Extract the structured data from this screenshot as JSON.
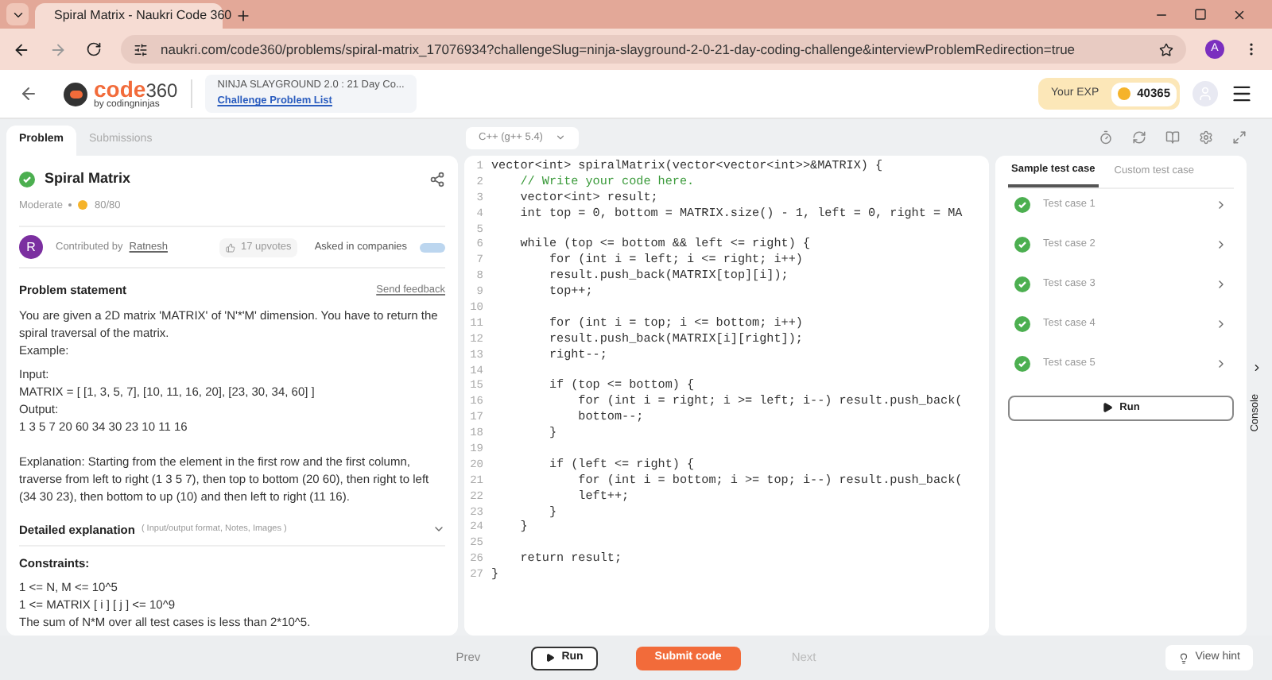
{
  "browser": {
    "tab_title": "Spiral Matrix - Naukri Code 360",
    "url": "naukri.com/code360/problems/spiral-matrix_17076934?challengeSlug=ninja-slayground-2-0-21-day-coding-challenge&interviewProblemRedirection=true",
    "profile_initial": "A"
  },
  "header": {
    "logo_main": "code",
    "logo_num": "360",
    "logo_sub": "by codingninjas",
    "challenge_title": "NINJA SLAYGROUND 2.0 : 21 Day Co...",
    "challenge_link": "Challenge Problem List",
    "exp_label": "Your EXP",
    "exp_value": "40365"
  },
  "problem_tabs": [
    {
      "label": "Problem",
      "selected": true
    },
    {
      "label": "Submissions",
      "selected": false
    }
  ],
  "language": "C++ (g++ 5.4)",
  "problem": {
    "title": "Spiral Matrix",
    "solved": true,
    "difficulty": "Moderate",
    "score": "80/80",
    "avatar_initial": "R",
    "contributed_label": "Contributed by",
    "contributor": "Ratnesh",
    "upvotes": "17 upvotes",
    "asked_label": "Asked in companies",
    "statement_heading": "Problem statement",
    "feedback": "Send feedback",
    "paragraphs": [
      "You are given a 2D matrix 'MATRIX' of 'N'*'M' dimension. You have to return the spiral traversal of the matrix.",
      "Example:"
    ],
    "example": [
      "Input:",
      "MATRIX = [ [1, 3, 5, 7], [10, 11, 16, 20], [23, 30, 34, 60] ]",
      "Output:",
      "1 3 5 7 20 60 34 30 23 10 11 16"
    ],
    "explanation": "Explanation: Starting from the element in the first row and the first column, traverse from left to right (1 3 5 7), then top to bottom (20 60), then right to left (34 30 23), then bottom to up (10) and then left to right (11 16).",
    "detailed_heading": "Detailed explanation",
    "detailed_hint": "( Input/output format, Notes, Images )",
    "expanded": false,
    "constraints_heading": "Constraints:",
    "constraints": [
      "1 <= N, M <= 10^5",
      "1 <= MATRIX [ i ] [ j ] <= 10^9",
      "The sum of N*M over all test cases is less than 2*10^5."
    ]
  },
  "code_lines": [
    {
      "num": "1",
      "text": "vector<int> spiralMatrix(vector<vector<int>>&MATRIX) {",
      "kind": "code"
    },
    {
      "num": "2",
      "text": "    // Write your code here.",
      "kind": "comment"
    },
    {
      "num": "3",
      "text": "    vector<int> result;",
      "kind": "code"
    },
    {
      "num": "4",
      "text": "    int top = 0, bottom = MATRIX.size() - 1, left = 0, right = MA",
      "kind": "code"
    },
    {
      "num": "5",
      "kind": "blank"
    },
    {
      "num": "6",
      "text": "    while (top <= bottom && left <= right) {",
      "kind": "code"
    },
    {
      "num": "7",
      "text": "        for (int i = left; i <= right; i++)",
      "kind": "code"
    },
    {
      "num": "8",
      "text": "        result.push_back(MATRIX[top][i]);",
      "kind": "code"
    },
    {
      "num": "9",
      "text": "        top++;",
      "kind": "code"
    },
    {
      "num": "10",
      "kind": "blank"
    },
    {
      "num": "11",
      "text": "        for (int i = top; i <= bottom; i++)",
      "kind": "code"
    },
    {
      "num": "12",
      "text": "        result.push_back(MATRIX[i][right]);",
      "kind": "code"
    },
    {
      "num": "13",
      "text": "        right--;",
      "kind": "code"
    },
    {
      "num": "14",
      "kind": "blank"
    },
    {
      "num": "15",
      "text": "        if (top <= bottom) {",
      "kind": "code"
    },
    {
      "num": "16",
      "text": "            for (int i = right; i >= left; i--) result.push_back(",
      "kind": "code"
    },
    {
      "num": "17",
      "text": "            bottom--;",
      "kind": "code"
    },
    {
      "num": "18",
      "text": "        }",
      "kind": "code"
    },
    {
      "num": "19",
      "kind": "blank"
    },
    {
      "num": "20",
      "text": "        if (left <= right) {",
      "kind": "code"
    },
    {
      "num": "21",
      "text": "            for (int i = bottom; i >= top; i--) result.push_back(",
      "kind": "code"
    },
    {
      "num": "22",
      "text": "            left++;",
      "kind": "code"
    },
    {
      "num": "23",
      "text": "        }",
      "kind": "code"
    },
    {
      "num": "24",
      "text": "    }",
      "kind": "code"
    },
    {
      "num": "25",
      "kind": "blank"
    },
    {
      "num": "26",
      "text": "    return result;",
      "kind": "code"
    },
    {
      "num": "27",
      "text": "}",
      "kind": "code"
    }
  ],
  "test_tabs": [
    {
      "label": "Sample test case",
      "selected": true
    },
    {
      "label": "Custom test case",
      "selected": false
    }
  ],
  "test_cases": [
    {
      "label": "Test case 1",
      "passed": true
    },
    {
      "label": "Test case 2",
      "passed": true
    },
    {
      "label": "Test case 3",
      "passed": true
    },
    {
      "label": "Test case 4",
      "passed": true
    },
    {
      "label": "Test case 5",
      "passed": true
    }
  ],
  "run_label": "Run",
  "console_label": "Console",
  "footer": {
    "prev": "Prev",
    "run": "Run",
    "submit": "Submit code",
    "next": "Next",
    "hint": "View hint"
  }
}
